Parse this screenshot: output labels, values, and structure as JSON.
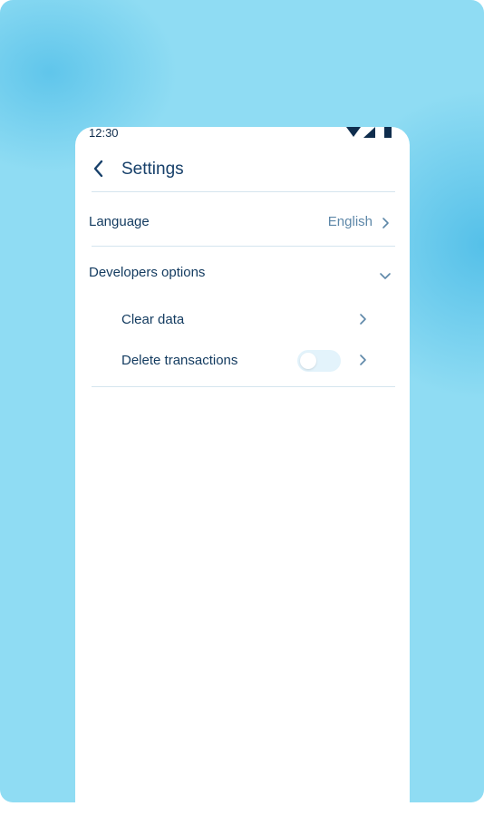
{
  "status_bar": {
    "time": "12:30",
    "icons": [
      "wifi-icon",
      "cellular-signal-icon",
      "battery-icon"
    ]
  },
  "header": {
    "title": "Settings",
    "back_icon": "chevron-left-icon"
  },
  "settings": {
    "language": {
      "label": "Language",
      "value": "English"
    },
    "developers_options": {
      "label": "Developers options",
      "expanded": true,
      "items": [
        {
          "label": "Clear data"
        },
        {
          "label": "Delete transactions",
          "toggle_on": false
        }
      ]
    }
  },
  "colors": {
    "background": "#8fdcf3",
    "text_primary": "#123a5f",
    "text_secondary": "#5d87a8",
    "divider": "#d5e5ee",
    "toggle_track": "#e3f3fb"
  }
}
